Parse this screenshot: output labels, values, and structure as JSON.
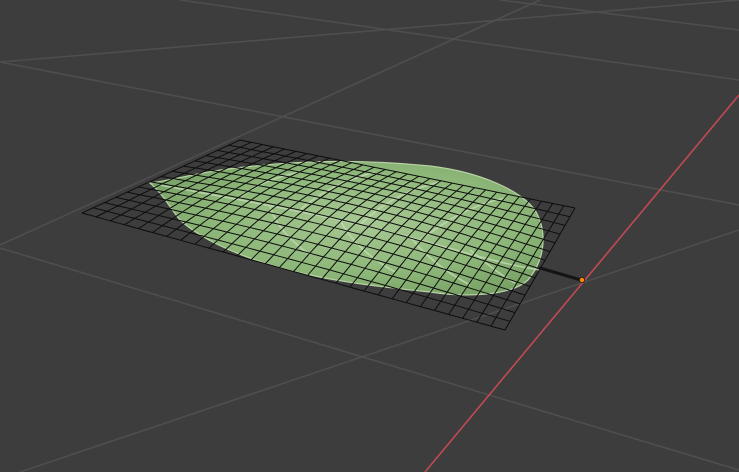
{
  "viewport": {
    "background_color": "#3d3d3d",
    "grid_color": "#4e4e4e",
    "x_axis_color": "#c04a55",
    "mesh_wire_color": "#0d0d0d",
    "leaf_fill_color": "#8fb87a",
    "leaf_vein_color": "#c6ddb7",
    "stem_color": "#141414",
    "origin_color": "#ff8a00"
  },
  "scene": {
    "mesh_name": "",
    "object_name": ""
  }
}
